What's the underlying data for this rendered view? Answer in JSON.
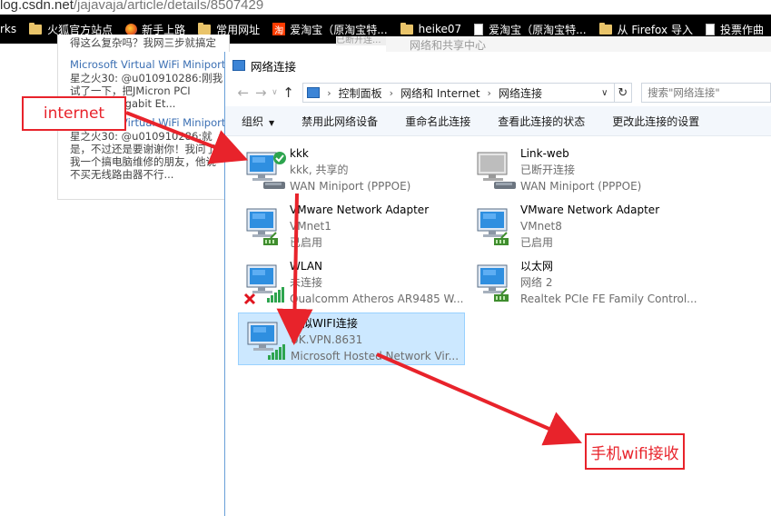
{
  "browser": {
    "url_prefix": "log.csdn.net",
    "url_path": "/jajavaja/article/details/8507429",
    "bookmarks": [
      {
        "label": "rks",
        "icon": "none"
      },
      {
        "label": "火狐官方站点",
        "icon": "folder-icon"
      },
      {
        "label": "新手上路",
        "icon": "firefox-icon"
      },
      {
        "label": "常用网址",
        "icon": "folder-icon"
      },
      {
        "label": "爱淘宝（原淘宝特...",
        "icon": "taobao-icon"
      },
      {
        "label": "heike07",
        "icon": "folder-icon"
      },
      {
        "label": "爱淘宝（原淘宝特...",
        "icon": "page-icon"
      },
      {
        "label": "从 Firefox 导入",
        "icon": "folder-icon"
      },
      {
        "label": "投票作曲",
        "icon": "page-icon"
      }
    ]
  },
  "background_page": {
    "comments": [
      {
        "text": "得这么复杂吗？我网三步就搞定",
        "kind": "text"
      },
      {
        "text": "Microsoft Virtual WiFi Miniport A",
        "kind": "link"
      },
      {
        "text": "星之火30: @u010910286:刚我",
        "kind": "text"
      },
      {
        "text": "试了一下，把JMicron PCI",
        "kind": "text"
      },
      {
        "text": "Express Gigabit Et...",
        "kind": "text"
      },
      {
        "text": "Microsoft Virtual WiFi Miniport A",
        "kind": "link"
      },
      {
        "text": "星之火30: @u010910286:就",
        "kind": "text"
      },
      {
        "text": "是，不过还是要谢谢你！我问了",
        "kind": "text"
      },
      {
        "text": "我一个搞电脑维修的朋友，他说",
        "kind": "text"
      },
      {
        "text": "不买无线路由器不行...",
        "kind": "text"
      }
    ],
    "behind_window_tab": "网络和共享中心",
    "behind_window_tab2": "已断开连..."
  },
  "window": {
    "title": "网络连接",
    "breadcrumbs": [
      "控制面板",
      "网络和 Internet",
      "网络连接"
    ],
    "search_placeholder": "搜索\"网络连接\"",
    "toolbar": {
      "organize": "组织",
      "disable": "禁用此网络设备",
      "rename": "重命名此连接",
      "view_status": "查看此连接的状态",
      "change_settings": "更改此连接的设置"
    },
    "connections": [
      {
        "name": "kkk",
        "status": "kkk, 共享的",
        "device": "WAN Miniport (PPPOE)",
        "icon": "dialup-connected-icon",
        "selected": false
      },
      {
        "name": "Link-web",
        "status": "已断开连接",
        "device": "WAN Miniport (PPPOE)",
        "icon": "dialup-disconnected-icon",
        "selected": false
      },
      {
        "name": "VMware Network Adapter",
        "status": "VMnet1",
        "device": "已启用",
        "icon": "ethernet-icon",
        "selected": false
      },
      {
        "name": "VMware Network Adapter",
        "status": "VMnet8",
        "device": "已启用",
        "icon": "ethernet-icon",
        "selected": false
      },
      {
        "name": "WLAN",
        "status": "未连接",
        "device": "Qualcomm Atheros AR9485 W...",
        "icon": "wifi-disconnected-icon",
        "selected": false
      },
      {
        "name": "以太网",
        "status": "网络 2",
        "device": "Realtek PCIe FE Family Control...",
        "icon": "ethernet-icon",
        "selected": false
      },
      {
        "name": "虚拟WIFI连接",
        "status": "UK.VPN.8631",
        "device": "Microsoft Hosted Network Vir...",
        "icon": "wifi-connected-icon",
        "selected": true
      }
    ]
  },
  "annotations": {
    "internet_label": "internet",
    "phone_label": "手机wifi接收",
    "color": "#e8232b"
  }
}
